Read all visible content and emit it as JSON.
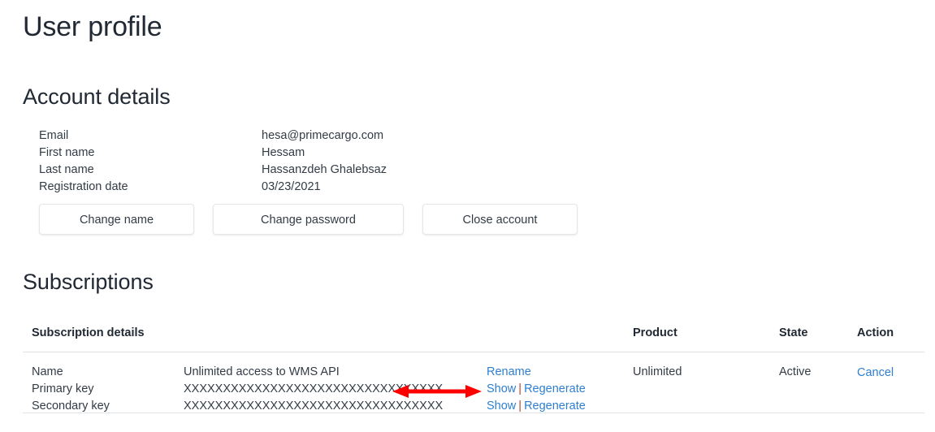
{
  "page": {
    "title": "User profile"
  },
  "account": {
    "heading": "Account details",
    "rows": [
      {
        "label": "Email",
        "value": "hesa@primecargo.com"
      },
      {
        "label": "First name",
        "value": "Hessam"
      },
      {
        "label": "Last name",
        "value": "Hassanzdeh Ghalebsaz"
      },
      {
        "label": "Registration date",
        "value": "03/23/2021"
      }
    ],
    "buttons": [
      {
        "label": "Change name"
      },
      {
        "label": "Change password"
      },
      {
        "label": "Close account"
      }
    ]
  },
  "subscriptions": {
    "heading": "Subscriptions",
    "columns": {
      "details": "Subscription details",
      "product": "Product",
      "state": "State",
      "action": "Action"
    },
    "rows": [
      {
        "lines": [
          {
            "label": "Name",
            "value": "Unlimited access to WMS API"
          },
          {
            "label": "Primary key",
            "value": "XXXXXXXXXXXXXXXXXXXXXXXXXXXXXXXXX"
          },
          {
            "label": "Secondary key",
            "value": "XXXXXXXXXXXXXXXXXXXXXXXXXXXXXXXXX"
          }
        ],
        "links": {
          "rename": "Rename",
          "show": "Show",
          "separator": "|",
          "regenerate": "Regenerate"
        },
        "product": "Unlimited",
        "state": "Active",
        "action": "Cancel"
      }
    ]
  },
  "annotation": {
    "type": "double-headed-arrow",
    "color": "#ff0000"
  },
  "colors": {
    "link": "#2f7fd1",
    "text": "#333b45",
    "heading": "#212934",
    "divider": "#dfe3e6",
    "annotation": "#ff0000"
  }
}
